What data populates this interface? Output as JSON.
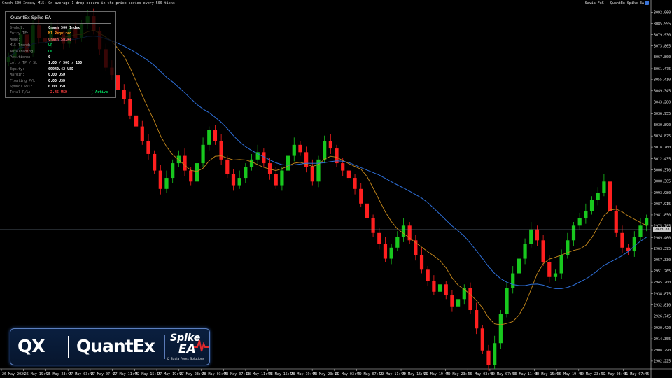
{
  "header": {
    "left": "Crash 500 Index, M15:  On average 1 drop occurs in the price series every 500 ticks",
    "right": "Savia FxS - QuantEx Spike EA"
  },
  "panel": {
    "title": "QuantEx Spike EA",
    "rows": [
      {
        "label": "Symbol:",
        "value": "Crash 500 Index",
        "color": "#ffffff"
      },
      {
        "label": "Entry TF:",
        "value": "M1 Required",
        "color": "#ff9a1f"
      },
      {
        "label": "Mode:",
        "value": "Crash Spike",
        "color": "#ff6a6a"
      },
      {
        "label": "M15 Trend:",
        "value": "UP",
        "color": "#00d05a"
      },
      {
        "label": "AutoTrading:",
        "value": "ON",
        "color": "#00d05a"
      },
      {
        "label": "Positions:",
        "value": "0",
        "color": "#ffffff"
      },
      {
        "label": "Lot / TP / SL:",
        "value": "1.00 / 500 / 100",
        "color": "#ffffff"
      },
      {
        "label": "Equity:",
        "value": "69940.42 USD",
        "color": "#ffffff"
      },
      {
        "label": "Margin:",
        "value": "0.00 USD",
        "color": "#ffffff"
      },
      {
        "label": "Floating P/L:",
        "value": "0.00 USD",
        "color": "#ffffff"
      },
      {
        "label": "Symbol P/L:",
        "value": "0.00 USD",
        "color": "#ffffff"
      },
      {
        "label": "Total P/L:",
        "value": "-2.45 USD",
        "color": "#ff4040"
      }
    ],
    "status": "[ Active ]"
  },
  "current_price": "2973.83",
  "logo": {
    "qx": "QX",
    "quantex": "QuantEx",
    "spike": "Spike",
    "ea": "EA",
    "copyright": "© Savia Forex Solutions"
  },
  "colors": {
    "bull": "#18c81e",
    "bear": "#ff1f1f",
    "ma_fast": "#c88a1c",
    "ma_slow": "#2e6fd8",
    "grid_line": "#8ca0b4"
  },
  "chart_data": {
    "type": "line",
    "note_kind": "candlestick",
    "y_ticks": [
      "3092.060",
      "3085.995",
      "3079.930",
      "3073.865",
      "3067.800",
      "3061.475",
      "3055.410",
      "3049.345",
      "3043.280",
      "3036.955",
      "3030.890",
      "3024.825",
      "3018.760",
      "3012.435",
      "3006.370",
      "3000.305",
      "2993.980",
      "2987.915",
      "2981.850",
      "2975.785",
      "2969.460",
      "2963.395",
      "2957.330",
      "2951.265",
      "2945.200",
      "2938.875",
      "2932.810",
      "2926.745",
      "2920.420",
      "2914.355",
      "2908.290",
      "2902.225"
    ],
    "x_ticks": [
      "26 May 2026",
      "26 May 19:45",
      "26 May 23:45",
      "27 May 03:45",
      "27 May 07:45",
      "27 May 11:45",
      "27 May 15:45",
      "27 May 19:45",
      "27 May 23:45",
      "28 May 03:45",
      "28 May 07:45",
      "28 May 11:45",
      "28 May 15:45",
      "28 May 19:45",
      "28 May 23:45",
      "29 May 03:45",
      "29 May 07:45",
      "29 May 11:45",
      "29 May 15:45",
      "29 May 19:45",
      "29 May 23:45",
      "30 May 03:45",
      "30 May 07:45",
      "30 May 11:45",
      "30 May 15:45",
      "30 May 19:45",
      "30 May 23:45",
      "31 May 03:45",
      "31 May 07:45"
    ],
    "close_series": [
      3068,
      3072,
      3080,
      3070,
      3085,
      3078,
      3076,
      3084,
      3080,
      3075,
      3083,
      3078,
      3086,
      3090,
      3082,
      3072,
      3062,
      3058,
      3050,
      3045,
      3036,
      3030,
      3022,
      3015,
      3006,
      2996,
      3002,
      3010,
      3014,
      3006,
      3000,
      3010,
      3020,
      3028,
      3022,
      3012,
      3004,
      2998,
      3002,
      3008,
      3012,
      3016,
      3010,
      3004,
      2998,
      3006,
      3014,
      3020,
      3016,
      3008,
      3000,
      3012,
      3022,
      3018,
      3010,
      3006,
      3002,
      2996,
      2988,
      2980,
      2972,
      2966,
      2958,
      2964,
      2970,
      2976,
      2968,
      2960,
      2952,
      2946,
      2940,
      2944,
      2938,
      2932,
      2936,
      2942,
      2930,
      2920,
      2908,
      2900,
      2912,
      2928,
      2942,
      2950,
      2958,
      2966,
      2974,
      2968,
      2956,
      2948,
      2950,
      2960,
      2968,
      2976,
      2980,
      2984,
      2990,
      2994,
      3000,
      2984,
      2972,
      2964,
      2962,
      2970,
      2976,
      2980
    ]
  }
}
